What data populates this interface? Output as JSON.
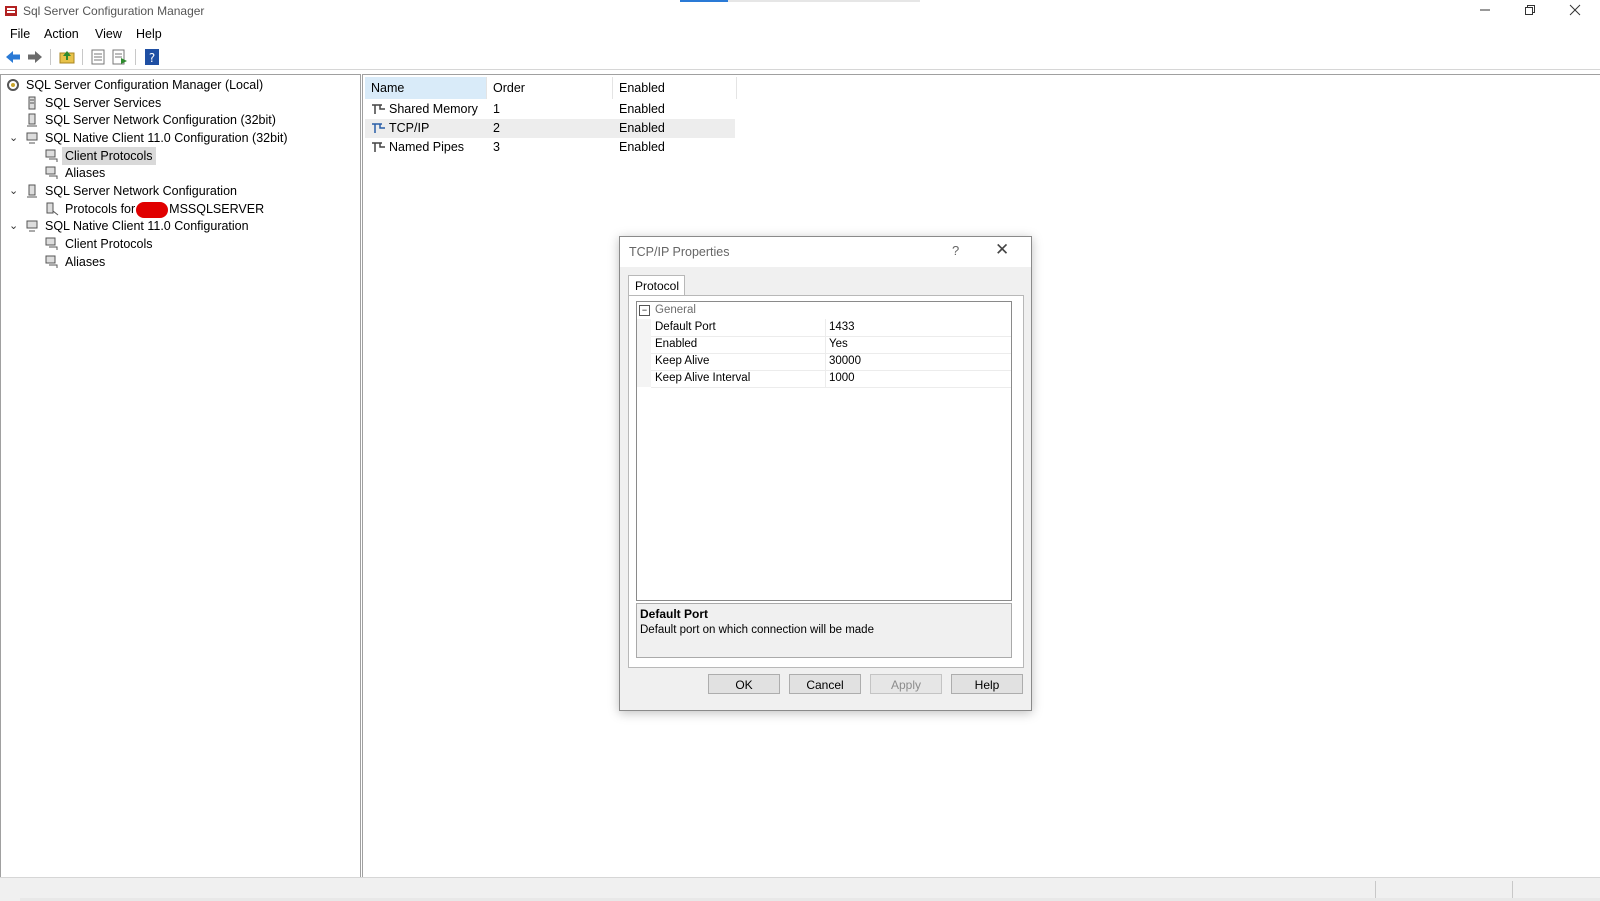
{
  "window": {
    "title": "Sql Server Configuration Manager",
    "minimize_icon": "minimize-icon",
    "maximize_icon": "restore-icon",
    "close_icon": "close-icon"
  },
  "menu": [
    "File",
    "Action",
    "View",
    "Help"
  ],
  "toolbar": {
    "buttons": [
      "back-arrow-icon",
      "forward-arrow-icon",
      "up-folder-icon",
      "properties-icon",
      "export-list-icon",
      "help-icon"
    ]
  },
  "tree": {
    "root": "SQL Server Configuration Manager (Local)",
    "items": [
      {
        "label": "SQL Server Services"
      },
      {
        "label": "SQL Server Network Configuration (32bit)"
      },
      {
        "label": "SQL Native Client 11.0 Configuration (32bit)",
        "expanded": true
      },
      {
        "label": "Client Protocols",
        "selected": true
      },
      {
        "label": "Aliases"
      },
      {
        "label": "SQL Server Network Configuration",
        "expanded": true
      },
      {
        "label_prefix": "Protocols for",
        "label_suffix": "MSSQLSERVER"
      },
      {
        "label": "SQL Native Client 11.0 Configuration",
        "expanded": true
      },
      {
        "label": "Client Protocols"
      },
      {
        "label": "Aliases"
      }
    ]
  },
  "list": {
    "columns": [
      "Name",
      "Order",
      "Enabled"
    ],
    "rows": [
      {
        "name": "Shared Memory",
        "order": "1",
        "enabled": "Enabled"
      },
      {
        "name": "TCP/IP",
        "order": "2",
        "enabled": "Enabled"
      },
      {
        "name": "Named Pipes",
        "order": "3",
        "enabled": "Enabled"
      }
    ]
  },
  "dialog": {
    "title": "TCP/IP Properties",
    "help_glyph": "?",
    "close_glyph": "✕",
    "tab": "Protocol",
    "category": "General",
    "collapse_glyph": "−",
    "properties": [
      {
        "key": "Default Port",
        "value": "1433"
      },
      {
        "key": "Enabled",
        "value": "Yes"
      },
      {
        "key": "Keep Alive",
        "value": "30000"
      },
      {
        "key": "Keep Alive Interval",
        "value": "1000"
      }
    ],
    "description_title": "Default Port",
    "description_text": "Default port on which connection will be made",
    "buttons": {
      "ok": "OK",
      "cancel": "Cancel",
      "apply": "Apply",
      "help": "Help"
    }
  },
  "colors": {
    "accent": "#2a7ad6",
    "redaction": "#e00000",
    "selection": "#d9d9d9"
  }
}
